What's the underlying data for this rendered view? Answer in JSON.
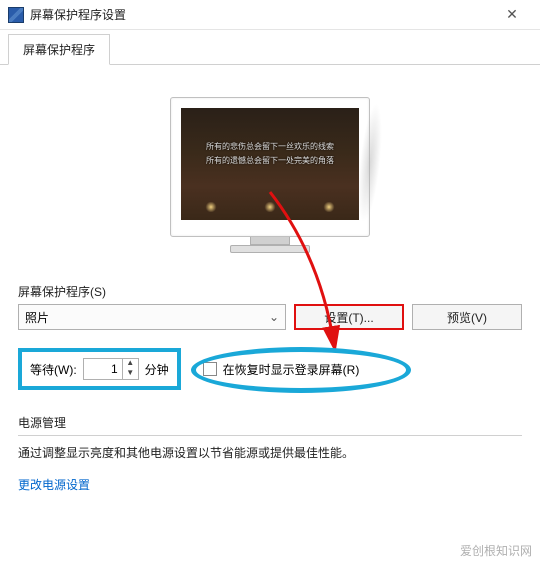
{
  "window": {
    "title": "屏幕保护程序设置"
  },
  "tabs": {
    "screensaver": "屏幕保护程序"
  },
  "preview": {
    "line1": "所有的悲伤总会留下一丝欢乐的线索",
    "line2": "所有的遗憾总会留下一处完美的角落"
  },
  "section": {
    "screensaver_label": "屏幕保护程序(S)"
  },
  "combo": {
    "selected": "照片"
  },
  "buttons": {
    "settings": "设置(T)...",
    "preview": "预览(V)"
  },
  "wait": {
    "label": "等待(W):",
    "value": "1",
    "unit": "分钟"
  },
  "resume": {
    "label": "在恢复时显示登录屏幕(R)"
  },
  "power": {
    "heading": "电源管理",
    "desc": "通过调整显示亮度和其他电源设置以节省能源或提供最佳性能。",
    "link": "更改电源设置"
  },
  "watermark": "爱创根知识网"
}
